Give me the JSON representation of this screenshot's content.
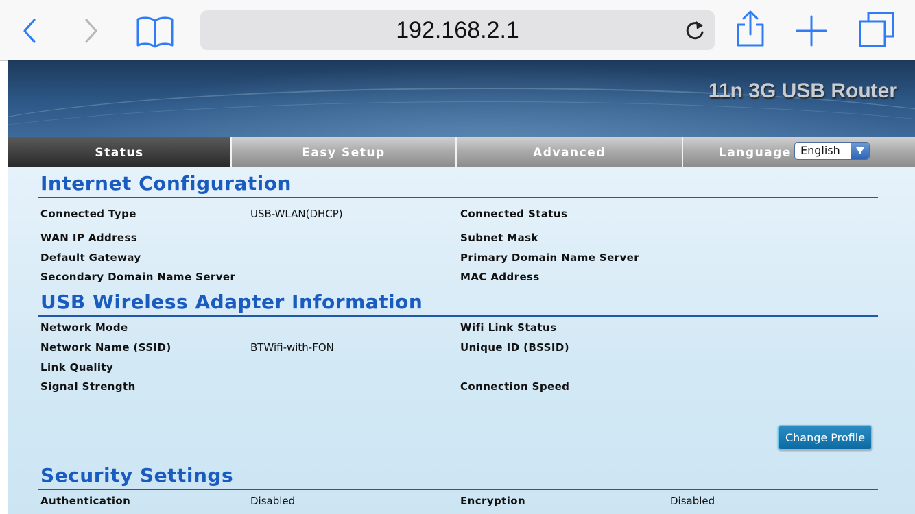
{
  "browser": {
    "url": "192.168.2.1",
    "icons": {
      "back": "chevron-left-icon",
      "forward": "chevron-right-icon",
      "bookmarks": "book-icon",
      "reload": "reload-icon",
      "share": "share-icon",
      "new_tab": "plus-icon",
      "tabs": "tabs-icon"
    },
    "accent_color": "#2f7cf6"
  },
  "header": {
    "brand": "11n 3G USB Router"
  },
  "nav": {
    "tabs": [
      {
        "label": "Status",
        "active": true
      },
      {
        "label": "Easy Setup",
        "active": false
      },
      {
        "label": "Advanced",
        "active": false
      },
      {
        "label": "Language",
        "active": false
      }
    ],
    "language_selected": "English"
  },
  "sections": {
    "internet": {
      "title": "Internet Configuration",
      "connected_type_label": "Connected Type",
      "connected_type_value": "USB-WLAN(DHCP)",
      "connected_status_label": "Connected Status",
      "wan_ip_label": "WAN IP Address",
      "subnet_mask_label": "Subnet Mask",
      "default_gateway_label": "Default Gateway",
      "primary_dns_label": "Primary Domain Name Server",
      "secondary_dns_label": "Secondary Domain Name Server",
      "mac_label": "MAC Address"
    },
    "usb_wireless": {
      "title": "USB Wireless Adapter Information",
      "network_mode_label": "Network Mode",
      "wifi_link_status_label": "Wifi Link Status",
      "ssid_label": "Network Name (SSID)",
      "ssid_value": "BTWifi-with-FON",
      "bssid_label": "Unique ID (BSSID)",
      "link_quality_label": "Link Quality",
      "signal_strength_label": "Signal Strength",
      "connection_speed_label": "Connection Speed",
      "change_profile_button": "Change Profile"
    },
    "security": {
      "title": "Security Settings",
      "authentication_label": "Authentication",
      "authentication_value": "Disabled",
      "encryption_label": "Encryption",
      "encryption_value": "Disabled"
    }
  },
  "colors": {
    "section_title": "#1a5bbf",
    "rule": "#1f5aa8",
    "button": "#0d6aa3"
  }
}
